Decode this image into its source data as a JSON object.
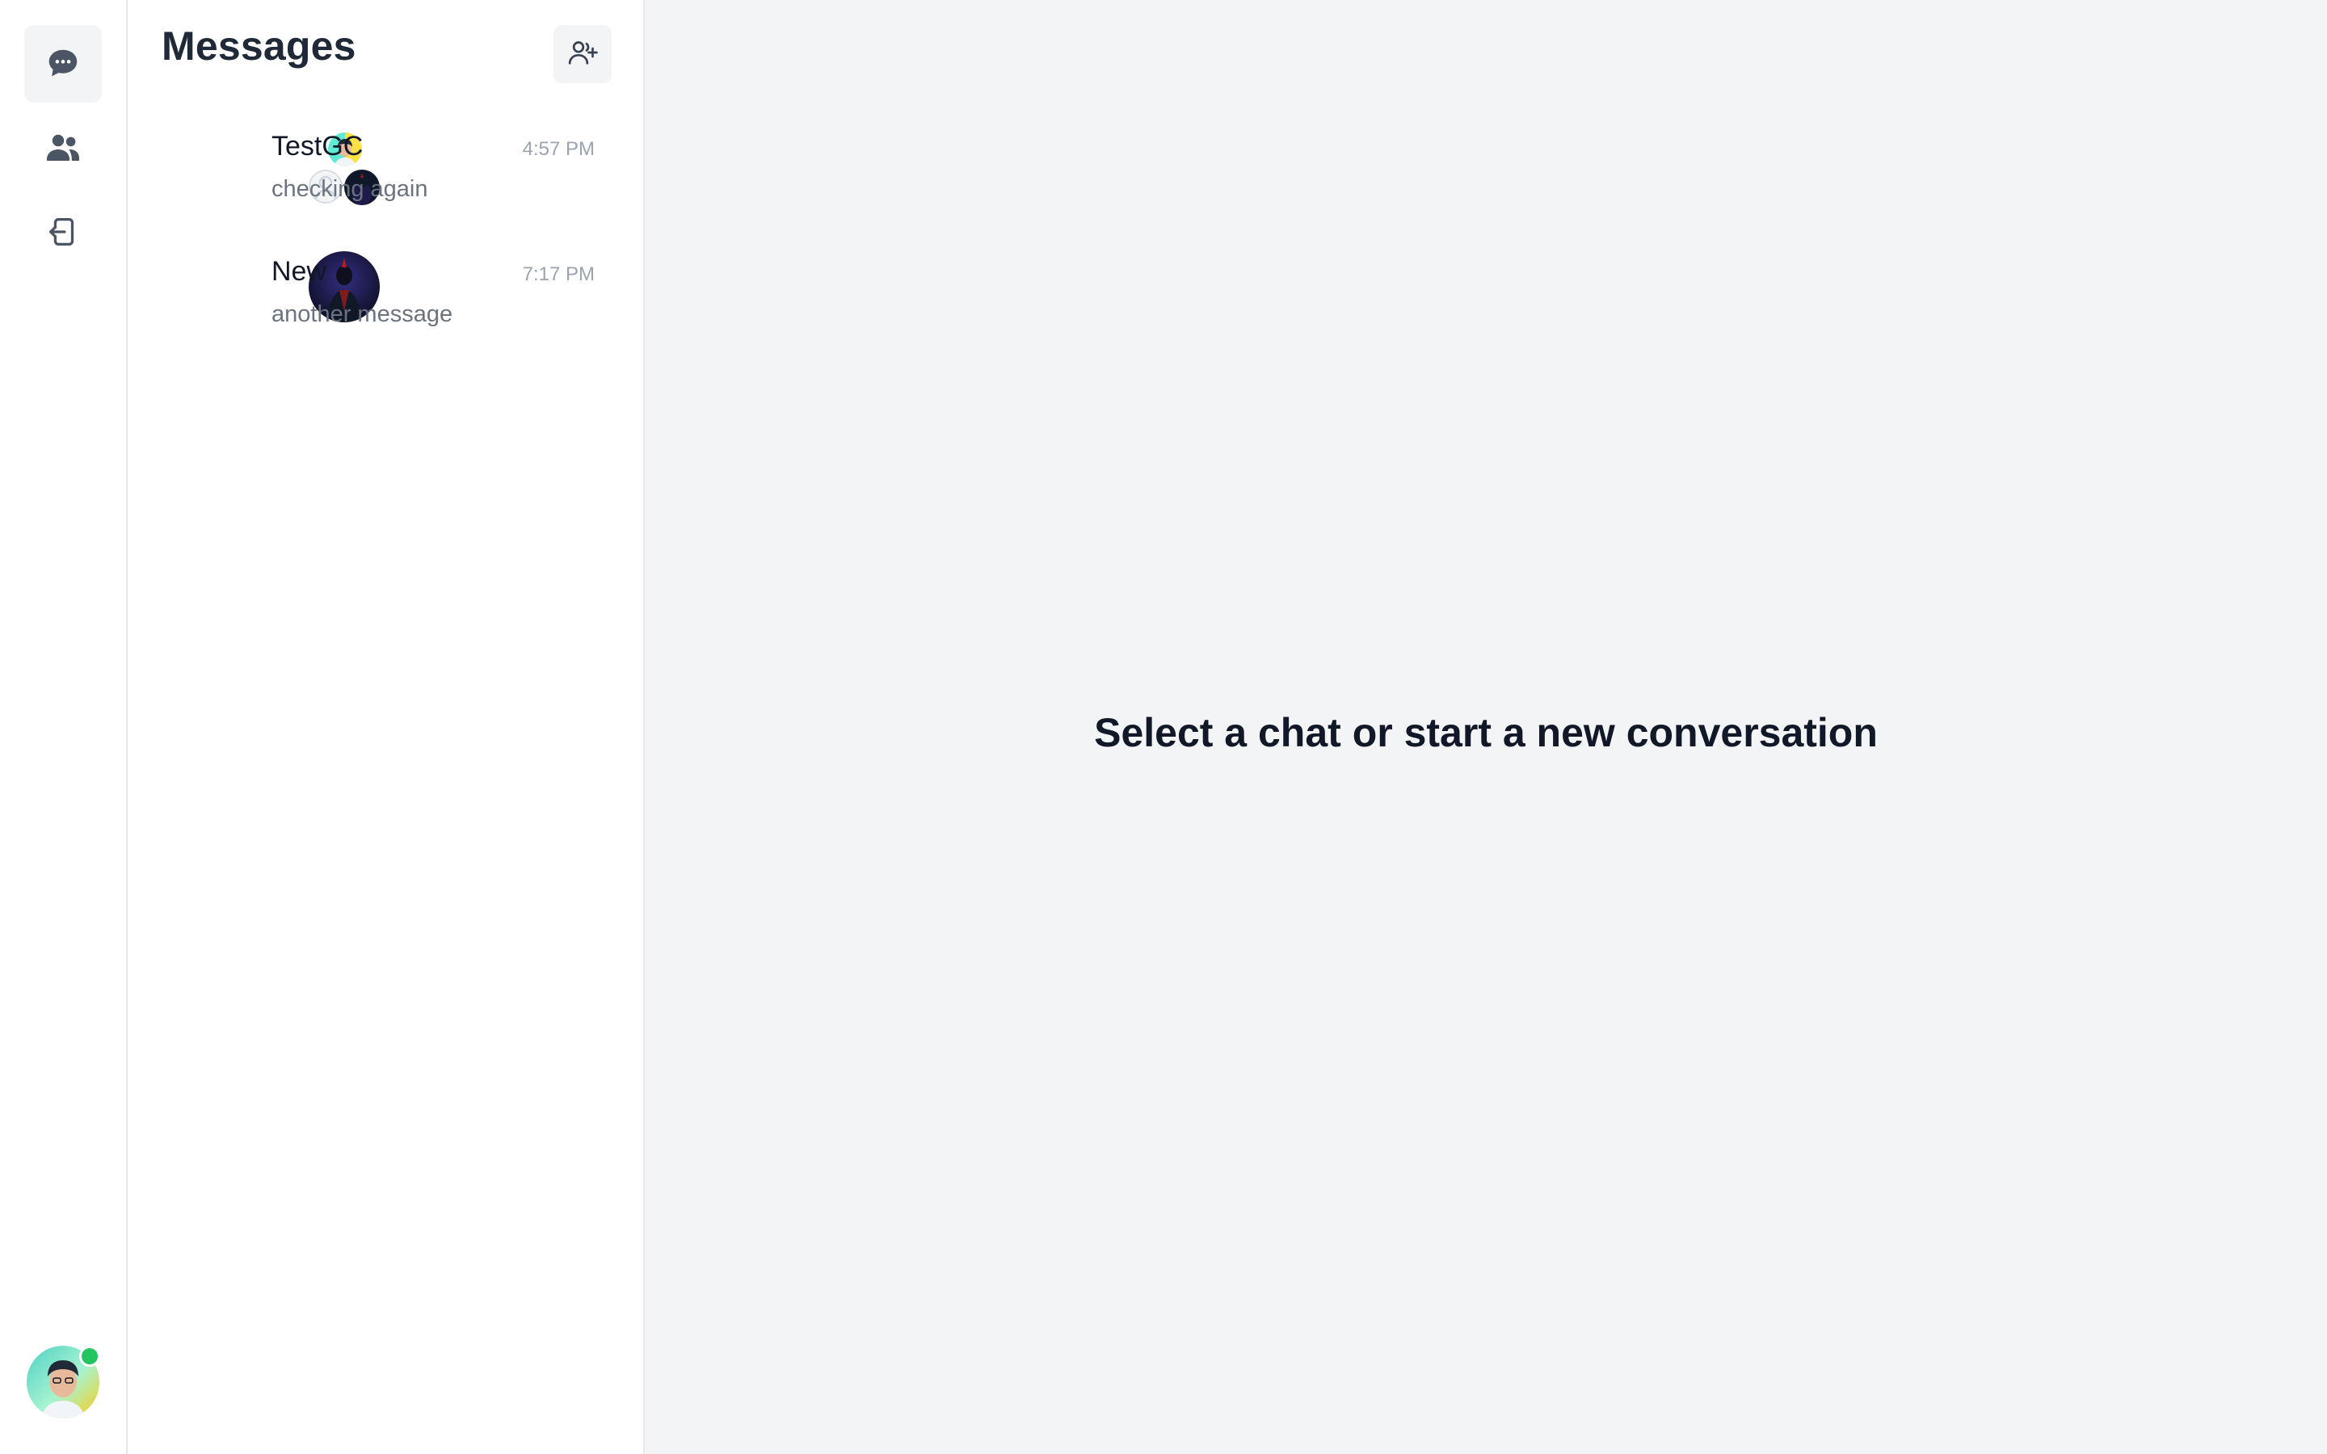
{
  "sidebar": {
    "nav": [
      {
        "icon": "chat-bubble-icon",
        "active": true
      },
      {
        "icon": "users-icon",
        "active": false
      },
      {
        "icon": "logout-icon",
        "active": false
      }
    ],
    "user": {
      "status": "online",
      "status_color": "#22c55e"
    }
  },
  "panel": {
    "title": "Messages",
    "new_chat_icon": "user-add-icon",
    "conversations": [
      {
        "name": "TestGC",
        "time": "4:57 PM",
        "preview": "checking again",
        "type": "group"
      },
      {
        "name": "New",
        "time": "7:17 PM",
        "preview": "another message",
        "type": "direct"
      }
    ]
  },
  "main": {
    "empty_state": "Select a chat or start a new conversation"
  },
  "colors": {
    "background": "#f3f4f6",
    "panel": "#ffffff",
    "text_primary": "#111827",
    "text_muted": "#6b7280",
    "online": "#22c55e"
  }
}
